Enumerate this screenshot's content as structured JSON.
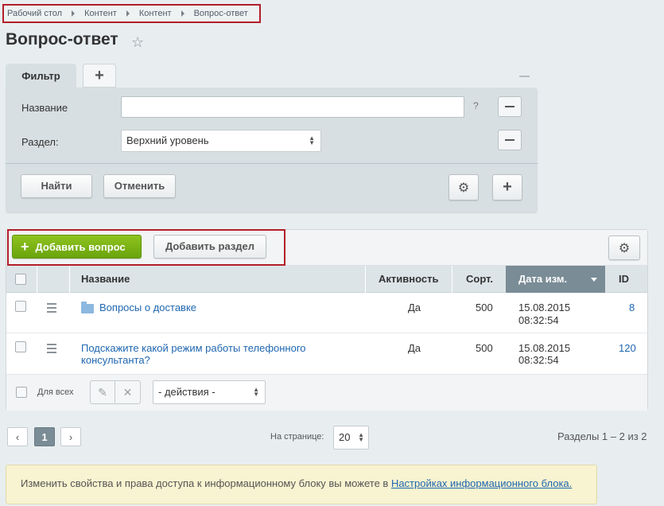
{
  "breadcrumb": [
    "Рабочий стол",
    "Контент",
    "Контент",
    "Вопрос-ответ"
  ],
  "page_title": "Вопрос-ответ",
  "filter": {
    "tab_label": "Фильтр",
    "add_tab_label": "+",
    "fields": [
      {
        "label": "Название",
        "value": "",
        "help": "?"
      },
      {
        "label": "Раздел:",
        "value": "Верхний уровень"
      }
    ],
    "find_label": "Найти",
    "cancel_label": "Отменить"
  },
  "toolbar": {
    "add_question": "Добавить вопрос",
    "add_section": "Добавить раздел"
  },
  "table": {
    "columns": [
      "Название",
      "Активность",
      "Сорт.",
      "Дата изм.",
      "ID"
    ],
    "rows": [
      {
        "name": "Вопросы о доставке",
        "is_folder": true,
        "active": "Да",
        "sort": "500",
        "date": "15.08.2015",
        "time": "08:32:54",
        "id": "8"
      },
      {
        "name_line1": "Подскажите какой режим работы телефонного",
        "name_line2": "консультанта?",
        "is_folder": false,
        "active": "Да",
        "sort": "500",
        "date": "15.08.2015",
        "time": "08:32:54",
        "id": "120"
      }
    ]
  },
  "group_actions": {
    "for_all": "Для всех",
    "actions_select": "- действия -"
  },
  "pager": {
    "prev": "‹",
    "current": "1",
    "next": "›",
    "per_page_label": "На странице:",
    "per_page_value": "20",
    "summary": "Разделы 1 – 2 из 2"
  },
  "info": {
    "text": "Изменить свойства и права доступа к информационному блоку вы можете в ",
    "link": "Настройках информационного блока."
  },
  "colors": {
    "accent_green": "#7cb518",
    "sorted_header": "#7a8c96",
    "highlight_red": "#b21e2a",
    "link": "#2067b0"
  }
}
